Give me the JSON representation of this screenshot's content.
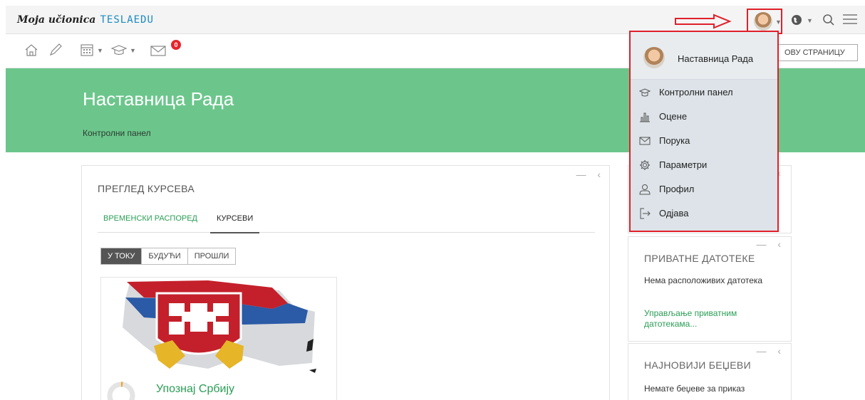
{
  "brand": {
    "part1": "Moja učionica",
    "part2": "TESLAEDU"
  },
  "notifications": {
    "count": "0"
  },
  "toolbar": {
    "edit_page_label": "ОВУ СТРАНИЦУ"
  },
  "hero": {
    "title": "Наставница Рада",
    "breadcrumb": "Контролни панел"
  },
  "course_overview": {
    "title": "ПРЕГЛЕД КУРСЕВА",
    "tabs": [
      "ВРЕМЕНСКИ РАСПОРЕД",
      "КУРСЕВИ"
    ],
    "filters": [
      "У ТОКУ",
      "БУДУЋИ",
      "ПРОШЛИ"
    ],
    "course_name": "Упознај Србију"
  },
  "private_files": {
    "title": "ПРИВАТНЕ ДАТОТЕКЕ",
    "empty_text": "Нема расположивих датотека",
    "manage_link": "Управљање приватним датотекама..."
  },
  "badges": {
    "title": "НАЈНОВИЈИ БЕЏЕВИ",
    "empty_text": "Немате беџеве за приказ"
  },
  "user_menu": {
    "name": "Наставница Рада",
    "items": [
      {
        "label": "Контролни панел",
        "icon": "mortarboard-icon"
      },
      {
        "label": "Оцене",
        "icon": "bar-chart-icon"
      },
      {
        "label": "Порука",
        "icon": "envelope-icon"
      },
      {
        "label": "Параметри",
        "icon": "gear-icon"
      },
      {
        "label": "Профил",
        "icon": "user-icon"
      },
      {
        "label": "Одјава",
        "icon": "logout-icon"
      }
    ]
  },
  "colors": {
    "accent_green": "#6cc68c",
    "link_green": "#2a9d55",
    "highlight_red": "#e0202a",
    "badge_red": "#e8232b"
  }
}
